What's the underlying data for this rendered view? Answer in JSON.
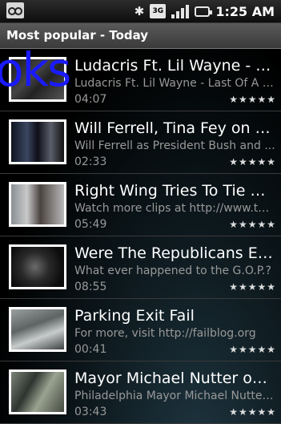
{
  "status_bar": {
    "time": "1:25 AM",
    "network_type": "3G",
    "icons": [
      "voicemail-icon",
      "bluetooth-icon",
      "3g-icon",
      "signal-icon",
      "battery-icon"
    ]
  },
  "header": {
    "title": "Most popular - Today"
  },
  "overlay_text": "oks",
  "videos": [
    {
      "title": "Ludacris Ft. Lil Wayne - Last Of A D...",
      "description": "Ludacris Ft. Lil Wayne - Last Of A D...",
      "duration": "04:07",
      "stars": "★★★★★"
    },
    {
      "title": "Will Ferrell, Tina Fey on SN...",
      "description": "Will Ferrell as President Bush and ...",
      "duration": "02:33",
      "stars": "★★★★★"
    },
    {
      "title": "Right Wing Tries To Tie Ob...",
      "description": "Watch more clips at http://www.the...",
      "duration": "05:49",
      "stars": "★★★★★"
    },
    {
      "title": "Were The Republicans Eve...",
      "description": "What ever happened to the G.O.P.?",
      "duration": "08:55",
      "stars": "★★★★★"
    },
    {
      "title": "Parking Exit Fail",
      "description": "For more, visit http://failblog.org",
      "duration": "00:41",
      "stars": "★★★★★"
    },
    {
      "title": "Mayor Michael Nutter on t...",
      "description": "Philadelphia Mayor Michael Nutter...",
      "duration": "03:43",
      "stars": "★★★★★"
    }
  ],
  "colors": {
    "overlay": "#1a1aff",
    "header_bg": "#4a4a4a",
    "secondary_text": "#999999"
  }
}
